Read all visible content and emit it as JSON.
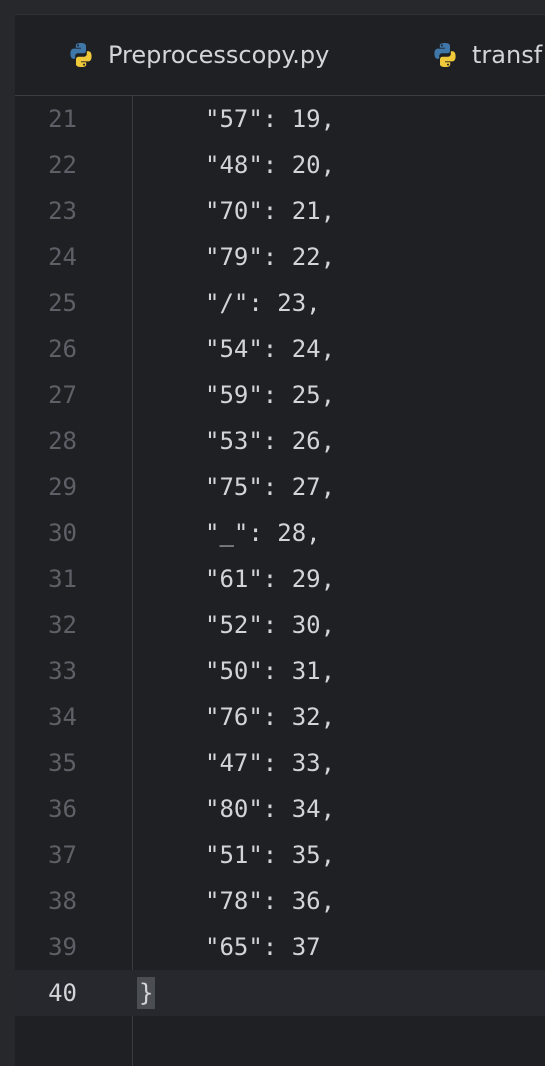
{
  "tabs": [
    {
      "label": "Preprocesscopy.py",
      "icon": "python-icon"
    },
    {
      "label": "transf",
      "icon": "python-icon"
    }
  ],
  "lines": [
    {
      "num": "21",
      "text": "\"57\": 19,"
    },
    {
      "num": "22",
      "text": "\"48\": 20,"
    },
    {
      "num": "23",
      "text": "\"70\": 21,"
    },
    {
      "num": "24",
      "text": "\"79\": 22,"
    },
    {
      "num": "25",
      "text": "\"/\": 23,"
    },
    {
      "num": "26",
      "text": "\"54\": 24,"
    },
    {
      "num": "27",
      "text": "\"59\": 25,"
    },
    {
      "num": "28",
      "text": "\"53\": 26,"
    },
    {
      "num": "29",
      "text": "\"75\": 27,"
    },
    {
      "num": "30",
      "text": "\"_\": 28,"
    },
    {
      "num": "31",
      "text": "\"61\": 29,"
    },
    {
      "num": "32",
      "text": "\"52\": 30,"
    },
    {
      "num": "33",
      "text": "\"50\": 31,"
    },
    {
      "num": "34",
      "text": "\"76\": 32,"
    },
    {
      "num": "35",
      "text": "\"47\": 33,"
    },
    {
      "num": "36",
      "text": "\"80\": 34,"
    },
    {
      "num": "37",
      "text": "\"51\": 35,"
    },
    {
      "num": "38",
      "text": "\"78\": 36,"
    },
    {
      "num": "39",
      "text": "\"65\": 37"
    }
  ],
  "current_line": {
    "num": "40",
    "text": "}"
  },
  "colors": {
    "background": "#1f2024",
    "text": "#d2d4d8",
    "line_number": "#5d6066",
    "python_blue": "#3f77a8",
    "python_yellow": "#f0c93a"
  }
}
